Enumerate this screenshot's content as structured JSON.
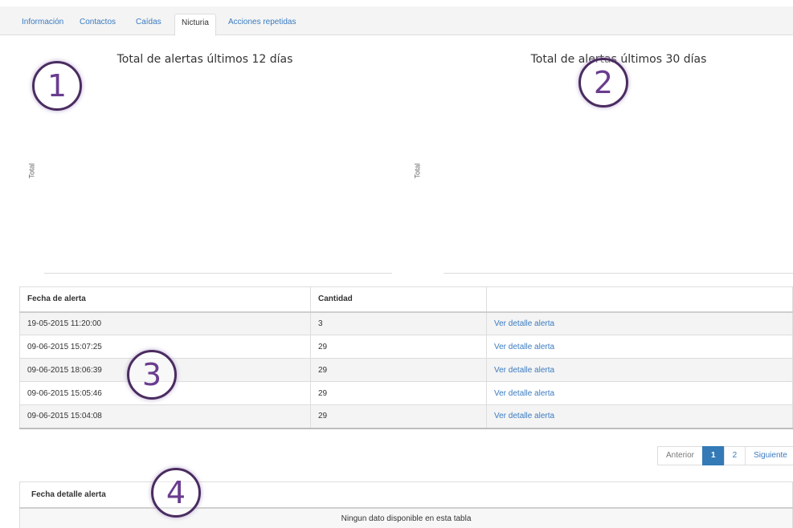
{
  "tabs": [
    {
      "label": "Información",
      "active": false
    },
    {
      "label": "Contactos",
      "active": false
    },
    {
      "label": "Caídas",
      "active": false
    },
    {
      "label": "Nicturia",
      "active": true
    },
    {
      "label": "Acciones repetidas",
      "active": false
    }
  ],
  "charts": [
    {
      "title": "Total de alertas últimos 12 días",
      "ylabel": "Total"
    },
    {
      "title": "Total de alertas últimos 30 días",
      "ylabel": "Total"
    }
  ],
  "markers": [
    "1",
    "2",
    "3",
    "4"
  ],
  "alerts_table": {
    "headers": [
      "Fecha de alerta",
      "Cantidad",
      ""
    ],
    "rows": [
      {
        "date": "19-05-2015 11:20:00",
        "count": "3",
        "link": "Ver detalle alerta"
      },
      {
        "date": "09-06-2015 15:07:25",
        "count": "29",
        "link": "Ver detalle alerta"
      },
      {
        "date": "09-06-2015 18:06:39",
        "count": "29",
        "link": "Ver detalle alerta"
      },
      {
        "date": "09-06-2015 15:05:46",
        "count": "29",
        "link": "Ver detalle alerta"
      },
      {
        "date": "09-06-2015 15:04:08",
        "count": "29",
        "link": "Ver detalle alerta"
      }
    ]
  },
  "pagination": {
    "previous": "Anterior",
    "pages": [
      "1",
      "2"
    ],
    "current": "1",
    "next": "Siguiente"
  },
  "detail_table": {
    "header": "Fecha detalle alerta",
    "empty_message": "Ningun dato disponible en esta tabla"
  },
  "colors": {
    "link": "#3a7bc0",
    "active_page": "#337ab7",
    "marker_border": "#4a2c60",
    "marker_text": "#6a3c8f"
  }
}
